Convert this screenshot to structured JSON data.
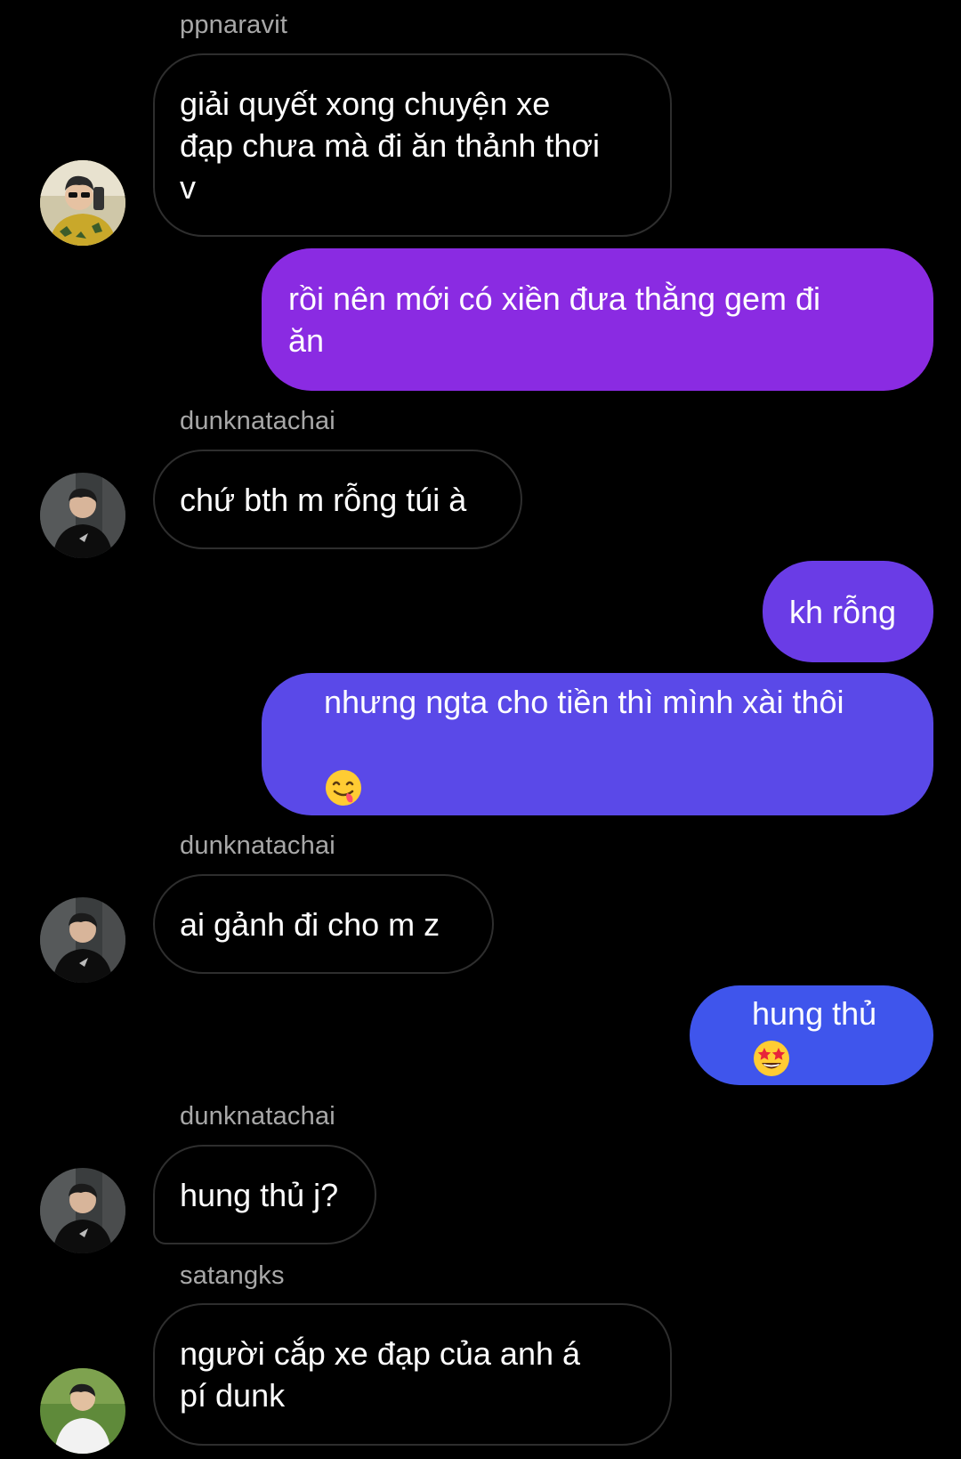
{
  "messages": [
    {
      "sender": "ppnaravit",
      "text": "giải quyết xong chuyện xe\nđạp chưa mà đi ăn thảnh thơi\nv"
    },
    {
      "text": "rồi nên mới có xiền đưa thằng gem đi\năn"
    },
    {
      "sender": "dunknatachai",
      "text": "chứ bth m rỗng túi à"
    },
    {
      "text": "kh rỗng"
    },
    {
      "text": "nhưng ngta cho tiền thì mình xài thôi",
      "emoji": "yum-face-emoji"
    },
    {
      "sender": "dunknatachai",
      "text": "ai gảnh đi cho m z"
    },
    {
      "text": "hung thủ",
      "emoji": "star-struck-emoji"
    },
    {
      "sender": "dunknatachai",
      "text": "hung thủ j?"
    },
    {
      "sender": "satangks",
      "text": "người cắp xe đạp của anh á\npí dunk"
    }
  ],
  "colors": {
    "outgoing_top": "#8a2be2",
    "outgoing_mid": "#5a49e8",
    "outgoing_bottom": "#3f55ec",
    "incoming_border": "#2e2e2e",
    "sender_label": "#a8a8a8",
    "background": "#000000"
  }
}
